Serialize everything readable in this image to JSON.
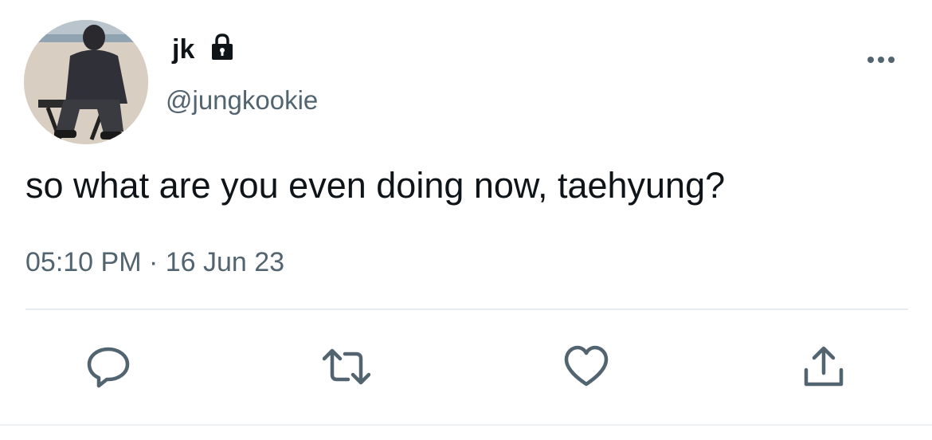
{
  "user": {
    "display_name": "jk",
    "handle": "@jungkookie",
    "protected_icon": "lock-icon",
    "avatar_icon": "profile-photo"
  },
  "tweet": {
    "text": "so what are you even doing now, taehyung?",
    "timestamp": "05:10 PM · 16 Jun 23"
  },
  "actions": [
    {
      "name": "reply",
      "icon": "speech-bubble-icon"
    },
    {
      "name": "retweet",
      "icon": "retweet-arrows-icon"
    },
    {
      "name": "like",
      "icon": "heart-icon"
    },
    {
      "name": "share",
      "icon": "share-arrow-icon"
    }
  ],
  "menu": {
    "icon": "more-dots-icon"
  },
  "colors": {
    "text_primary": "#0f1419",
    "text_secondary": "#536471",
    "icon": "#536471",
    "divider": "#e6ecf0"
  }
}
